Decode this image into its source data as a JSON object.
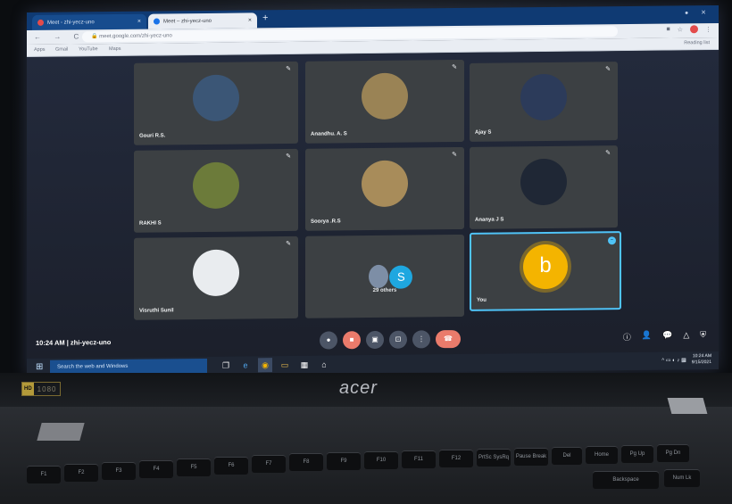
{
  "browser": {
    "tabs": [
      {
        "label": "Meet - zhi-yecz-uno",
        "favicon_color": "#e34b4b",
        "active": false
      },
      {
        "label": "Meet – zhi-yecz-uno",
        "favicon_color": "#1a73e8",
        "active": true
      }
    ],
    "url": "meet.google.com/zhi-yecz-uno",
    "bookmarks": [
      "Apps",
      "Gmail",
      "YouTube",
      "Maps"
    ],
    "reading_list": "Reading list"
  },
  "meet": {
    "tiles": [
      {
        "name": "Gouri R.S.",
        "avatar_color": "#3b5676"
      },
      {
        "name": "Anandhu. A. S",
        "avatar_color": "#9a8355"
      },
      {
        "name": "Ajay S",
        "avatar_color": "#2c3b5a"
      },
      {
        "name": "RAKHI S",
        "avatar_color": "#6c7b3a"
      },
      {
        "name": "Soorya .R.S",
        "avatar_color": "#a88c5a"
      },
      {
        "name": "Ananya J S",
        "avatar_color": "#1f2735"
      },
      {
        "name": "Visruthi Sunil",
        "avatar_color": "#e9ecef"
      }
    ],
    "others_initial": "S",
    "others_label": "29 others",
    "you_name": "You",
    "you_initial": "b",
    "meeting_info": "10:24 AM | zhi-yecz-uno",
    "controls": [
      {
        "name": "mic",
        "glyph": "●"
      },
      {
        "name": "camera",
        "glyph": "■"
      },
      {
        "name": "captions",
        "glyph": "▣"
      },
      {
        "name": "present",
        "glyph": "⊡"
      },
      {
        "name": "more",
        "glyph": "⋮"
      },
      {
        "name": "leave",
        "glyph": "☎"
      }
    ],
    "right_icons": [
      "ⓘ",
      "👤",
      "💬",
      "△",
      "⛨"
    ]
  },
  "taskbar": {
    "search_placeholder": "Search the web and Windows",
    "time": "10:24 AM",
    "date": "9/15/2021"
  },
  "laptop": {
    "hd_label": "HD",
    "resolution": "1080",
    "brand": "acer",
    "keys": [
      "F1",
      "F2",
      "F3",
      "F4",
      "F5",
      "F6",
      "F7",
      "F8",
      "F9",
      "F10",
      "F11",
      "F12",
      "PrtSc SysRq",
      "Pause Break",
      "Del",
      "Home",
      "Pg Up",
      "Pg Dn",
      "Backspace",
      "Num Lk"
    ]
  }
}
